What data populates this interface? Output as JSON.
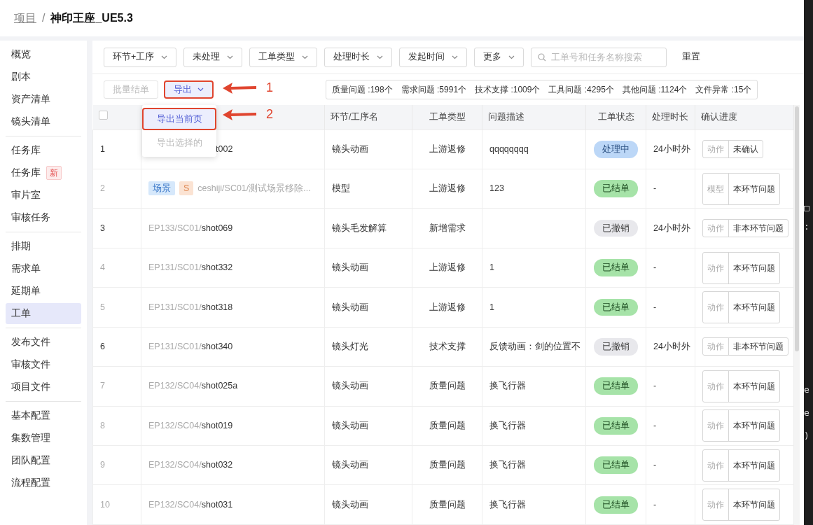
{
  "breadcrumb": {
    "parent": "项目",
    "separator": "/",
    "current": "神印王座_UE5.3"
  },
  "sidebar": {
    "groups": [
      [
        {
          "label": "概览",
          "selected": false
        },
        {
          "label": "剧本",
          "selected": false
        },
        {
          "label": "资产清单",
          "selected": false
        },
        {
          "label": "镜头清单",
          "selected": false
        }
      ],
      [
        {
          "label": "任务库",
          "selected": false
        },
        {
          "label": "任务库",
          "selected": false,
          "badge": "新"
        },
        {
          "label": "审片室",
          "selected": false
        },
        {
          "label": "审核任务",
          "selected": false
        }
      ],
      [
        {
          "label": "排期",
          "selected": false
        },
        {
          "label": "需求单",
          "selected": false
        },
        {
          "label": "延期单",
          "selected": false
        },
        {
          "label": "工单",
          "selected": true
        }
      ],
      [
        {
          "label": "发布文件",
          "selected": false
        },
        {
          "label": "审核文件",
          "selected": false
        },
        {
          "label": "项目文件",
          "selected": false
        }
      ],
      [
        {
          "label": "基本配置",
          "selected": false
        },
        {
          "label": "集数管理",
          "selected": false
        },
        {
          "label": "团队配置",
          "selected": false
        },
        {
          "label": "流程配置",
          "selected": false
        }
      ]
    ]
  },
  "filters": {
    "dropdowns": [
      "环节+工序",
      "未处理",
      "工单类型",
      "处理时长",
      "发起时间",
      "更多"
    ],
    "search": {
      "placeholder": "工单号和任务名称搜索"
    },
    "reset": "重置"
  },
  "toolbar": {
    "batch_close": {
      "label": "批量结单",
      "disabled": true
    },
    "export": {
      "label": "导出",
      "highlighted": true
    },
    "stats": [
      "质量问题 :198个",
      "需求问题 :5991个",
      "技术支撑 :1009个",
      "工具问题 :4295个",
      "其他问题 :1124个",
      "文件异常 :15个"
    ]
  },
  "export_menu": [
    {
      "label": "导出当前页",
      "selected": true,
      "disabled": false,
      "highlighted": true
    },
    {
      "label": "导出选择的",
      "selected": false,
      "disabled": true,
      "highlighted": false
    }
  ],
  "annotations": [
    {
      "label": "1"
    },
    {
      "label": "2"
    }
  ],
  "table": {
    "select_all": {
      "checked": false
    },
    "columns": [
      "环节/工序名",
      "工单类型",
      "问题描述",
      "工单状态",
      "处理时长",
      "确认进度"
    ],
    "rows": [
      {
        "index": "1",
        "partly_hidden": true,
        "path_name": "t002",
        "step": "镜头动画",
        "type": "上游返修",
        "description": "qqqqqqqq",
        "status": {
          "kind": "processing",
          "label": "处理中"
        },
        "duration": "24小时外",
        "confirm": [
          "动作",
          "未确认"
        ]
      },
      {
        "index": "2",
        "partly_hidden": false,
        "tags": [
          {
            "label": "场景",
            "color": "#d6e8fb"
          },
          {
            "label": "S",
            "color": "#fbe3d3"
          }
        ],
        "asset_path": "ceshiji/SC01/测试场景移除...",
        "step": "模型",
        "type": "上游返修",
        "description": "123",
        "status": {
          "kind": "done",
          "label": "已结单"
        },
        "duration": "-",
        "confirm": [
          "模型",
          "本环节问题"
        ]
      },
      {
        "index": "3",
        "partly_hidden": false,
        "path_prefix": "EP133/SC01/",
        "path_name": "shot069",
        "step": "镜头毛发解算",
        "type": "新增需求",
        "status": {
          "kind": "cancelled",
          "label": "已撤销"
        },
        "duration": "24小时外",
        "confirm": [
          "动作",
          "非本环节问题"
        ]
      },
      {
        "index": "4",
        "partly_hidden": false,
        "path_prefix": "EP131/SC01/",
        "path_name": "shot332",
        "step": "镜头动画",
        "type": "上游返修",
        "description": "1",
        "status": {
          "kind": "done",
          "label": "已结单"
        },
        "duration": "-",
        "confirm": [
          "动作",
          "本环节问题"
        ]
      },
      {
        "index": "5",
        "partly_hidden": false,
        "path_prefix": "EP131/SC01/",
        "path_name": "shot318",
        "step": "镜头动画",
        "type": "上游返修",
        "description": "1",
        "status": {
          "kind": "done",
          "label": "已结单"
        },
        "duration": "-",
        "confirm": [
          "动作",
          "本环节问题"
        ]
      },
      {
        "index": "6",
        "partly_hidden": false,
        "path_prefix": "EP131/SC01/",
        "path_name": "shot340",
        "step": "镜头灯光",
        "type": "技术支撑",
        "description": "反馈动画：剑的位置不",
        "status": {
          "kind": "cancelled",
          "label": "已撤销"
        },
        "duration": "24小时外",
        "confirm": [
          "动作",
          "非本环节问题"
        ]
      },
      {
        "index": "7",
        "partly_hidden": false,
        "path_prefix": "EP132/SC04/",
        "path_name": "shot025a",
        "step": "镜头动画",
        "type": "质量问题",
        "description": "换飞行器",
        "status": {
          "kind": "done",
          "label": "已结单"
        },
        "duration": "-",
        "confirm": [
          "动作",
          "本环节问题"
        ]
      },
      {
        "index": "8",
        "partly_hidden": false,
        "path_prefix": "EP132/SC04/",
        "path_name": "shot019",
        "step": "镜头动画",
        "type": "质量问题",
        "description": "换飞行器",
        "status": {
          "kind": "done",
          "label": "已结单"
        },
        "duration": "-",
        "confirm": [
          "动作",
          "本环节问题"
        ]
      },
      {
        "index": "9",
        "partly_hidden": false,
        "path_prefix": "EP132/SC04/",
        "path_name": "shot032",
        "step": "镜头动画",
        "type": "质量问题",
        "description": "换飞行器",
        "status": {
          "kind": "done",
          "label": "已结单"
        },
        "duration": "-",
        "confirm": [
          "动作",
          "本环节问题"
        ]
      },
      {
        "index": "10",
        "partly_hidden": false,
        "path_prefix": "EP132/SC04/",
        "path_name": "shot031",
        "step": "镜头动画",
        "type": "质量问题",
        "description": "换飞行器",
        "status": {
          "kind": "done",
          "label": "已结单"
        },
        "duration": "-",
        "confirm": [
          "动作",
          "本环节问题"
        ]
      }
    ]
  },
  "background_window": {
    "lines": [
      "□",
      ":",
      "e",
      "e",
      ")"
    ]
  }
}
